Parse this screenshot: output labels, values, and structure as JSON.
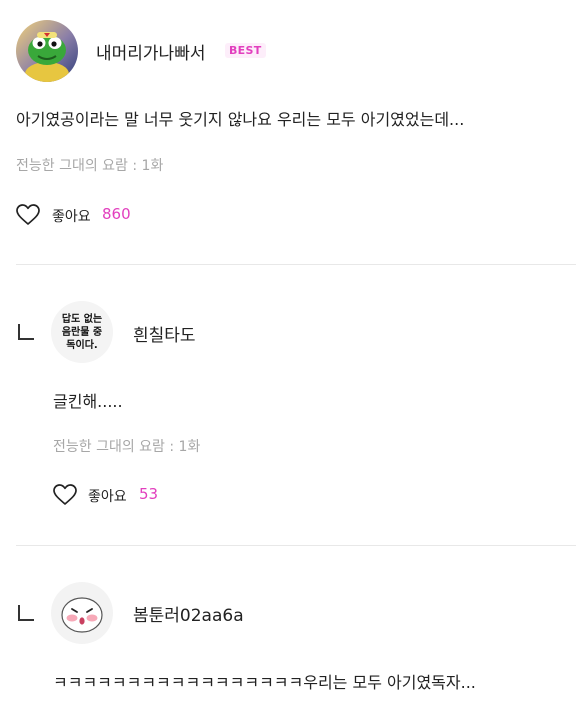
{
  "comments": [
    {
      "username": "내머리가나빠서",
      "badge": "BEST",
      "text": "아기였공이라는 말 너무 웃기지 않나요 우리는 모두 아기였었는데...",
      "episode": "전능한 그대의 요람 : 1화",
      "like_label": "좋아요",
      "like_count": "860",
      "avatar_icon": "frog-character-avatar"
    },
    {
      "username": "흰칠타도",
      "avatar_text": "답도 없는 음란물 중독이다.",
      "text": "글킨해.....",
      "episode": "전능한 그대의 요람 : 1화",
      "like_label": "좋아요",
      "like_count": "53"
    },
    {
      "username": "봄툰러02aa6a",
      "text": "ㅋㅋㅋㅋㅋㅋㅋㅋㅋㅋㅋㅋㅋㅋㅋㅋㅋ우리는 모두 아기였독자...",
      "avatar_icon": "blushing-face-avatar"
    }
  ],
  "colors": {
    "accent": "#e23fbe",
    "muted": "#a7a7a7",
    "divider": "#e8e8e8"
  }
}
